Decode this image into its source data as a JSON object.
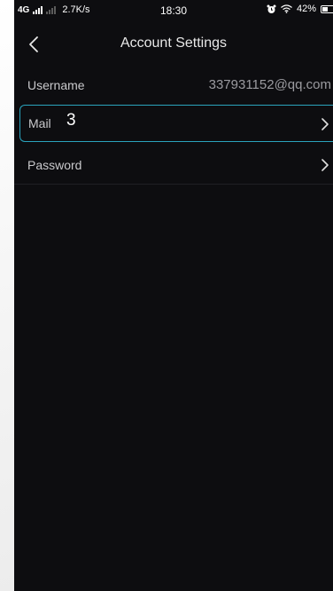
{
  "status_bar": {
    "network": "4G",
    "speed": "2.7K/s",
    "time": "18:30",
    "battery": "42%",
    "battery_level": 0.42
  },
  "header": {
    "title": "Account Settings",
    "back_icon": "chevron-left-icon"
  },
  "settings": {
    "username": {
      "label": "Username",
      "value": "337931152@qq.com"
    },
    "mail": {
      "label": "Mail",
      "annotation": "3"
    },
    "password": {
      "label": "Password"
    }
  },
  "colors": {
    "background": "#0d0d10",
    "highlight": "#2aa3bd",
    "label": "#c9c9cc",
    "value": "#9b9ba0"
  }
}
